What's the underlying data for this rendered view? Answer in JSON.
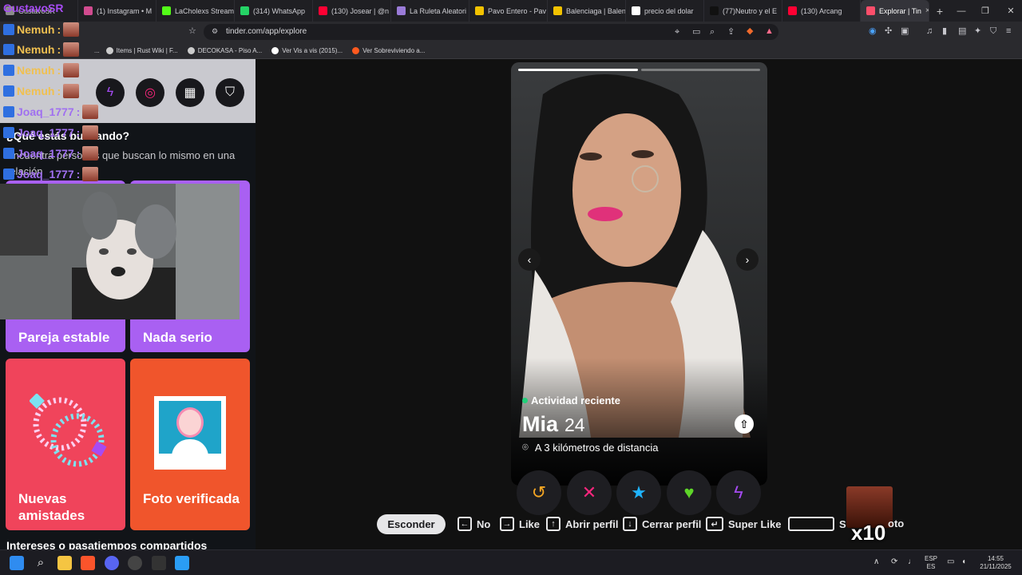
{
  "tabs": [
    {
      "label": "GustavoSR",
      "fav": "#8b8b8b"
    },
    {
      "label": "(1) Instagram • M",
      "fav": "#d14b8f"
    },
    {
      "label": "LaCholexs Stream",
      "fav": "#53fc18"
    },
    {
      "label": "(314) WhatsApp",
      "fav": "#25d366"
    },
    {
      "label": "(130) Josear | @n",
      "fav": "#ff0033"
    },
    {
      "label": "La Ruleta Aleatori",
      "fav": "#9a7bd8"
    },
    {
      "label": "Pavo Entero - Pav",
      "fav": "#f2c200"
    },
    {
      "label": "Balenciaga | Balen",
      "fav": "#f2c200"
    },
    {
      "label": "precio del dolar",
      "fav": "#ffffff"
    },
    {
      "label": "(77)Neutro y el E",
      "fav": "#111111"
    },
    {
      "label": "(130) Arcang",
      "fav": "#ff0033"
    },
    {
      "label": "Explorar | Tin",
      "fav": "#fd4e6b"
    }
  ],
  "tab_close": "×",
  "new_tab": "+",
  "window_controls": {
    "minimize": "—",
    "restore": "❐",
    "close": "✕"
  },
  "address": {
    "url": "tinder.com/app/explore"
  },
  "bookmarks": [
    {
      "label": "Items | Rust Wiki | F...",
      "color": "#cccccc"
    },
    {
      "label": "DECOKASA - Piso A...",
      "color": "#cccccc"
    },
    {
      "label": "Ver Vis a vis (2015)...",
      "color": "#ffffff"
    },
    {
      "label": "Ver Sobreviviendo a...",
      "color": "#ff5a1f"
    }
  ],
  "bookmark_partial": "...",
  "left": {
    "title": "¿Qué estás buscando?",
    "subtitle": "Encuentra personas que buscan lo mismo en una relación",
    "cards": [
      {
        "label": "Pareja estable",
        "color": "#a960f2"
      },
      {
        "label": "Nada serio",
        "color": "#a960f2"
      },
      {
        "label": "Nuevas amistades",
        "color": "#f0445b"
      },
      {
        "label": "Foto verificada",
        "color": "#f0552c"
      }
    ],
    "interests": "Intereses o pasatiempos compartidos"
  },
  "chat": [
    {
      "user": "Nemuh",
      "sep": ":",
      "color": "#f0c050"
    },
    {
      "user": "Nemuh",
      "sep": ":",
      "color": "#f0c050"
    },
    {
      "user": "Nemuh",
      "sep": ":",
      "color": "#f0c050"
    },
    {
      "user": "Nemuh",
      "sep": ":",
      "color": "#f0c050"
    },
    {
      "user": "Joaq_1777",
      "sep": ":",
      "color": "#a070f0"
    },
    {
      "user": "Joaq_1777",
      "sep": ":",
      "color": "#a070f0"
    },
    {
      "user": "Joaq_1777",
      "sep": ":",
      "color": "#a070f0"
    },
    {
      "user": "Joaq_1777",
      "sep": ":",
      "color": "#a070f0"
    }
  ],
  "streamer_name": "GustavoSR",
  "profile": {
    "activity": "Actividad reciente",
    "name": "Mia",
    "age": "24",
    "distance": "A 3 kilómetros de distancia",
    "photos_total": 2,
    "photo_current": 1
  },
  "actions": [
    {
      "name": "rewind",
      "glyph": "↺",
      "color": "#f5a623"
    },
    {
      "name": "nope",
      "glyph": "✕",
      "color": "#fd267d"
    },
    {
      "name": "super-like",
      "glyph": "★",
      "color": "#1fb4ff"
    },
    {
      "name": "like",
      "glyph": "♥",
      "color": "#5ed629"
    },
    {
      "name": "boost",
      "glyph": "ϟ",
      "color": "#a64bf4"
    }
  ],
  "hints": {
    "hide": "Esconder",
    "no": "No",
    "like": "Like",
    "open": "Abrir perfil",
    "close": "Cerrar perfil",
    "super": "Super Like",
    "next_photo_partial": "S",
    "next_photo_tail": "oto"
  },
  "overlay_multiplier": "x10",
  "tray": {
    "lang": "ESP",
    "lang2": "ES",
    "time": "14:55",
    "date": "21/11/2025"
  }
}
